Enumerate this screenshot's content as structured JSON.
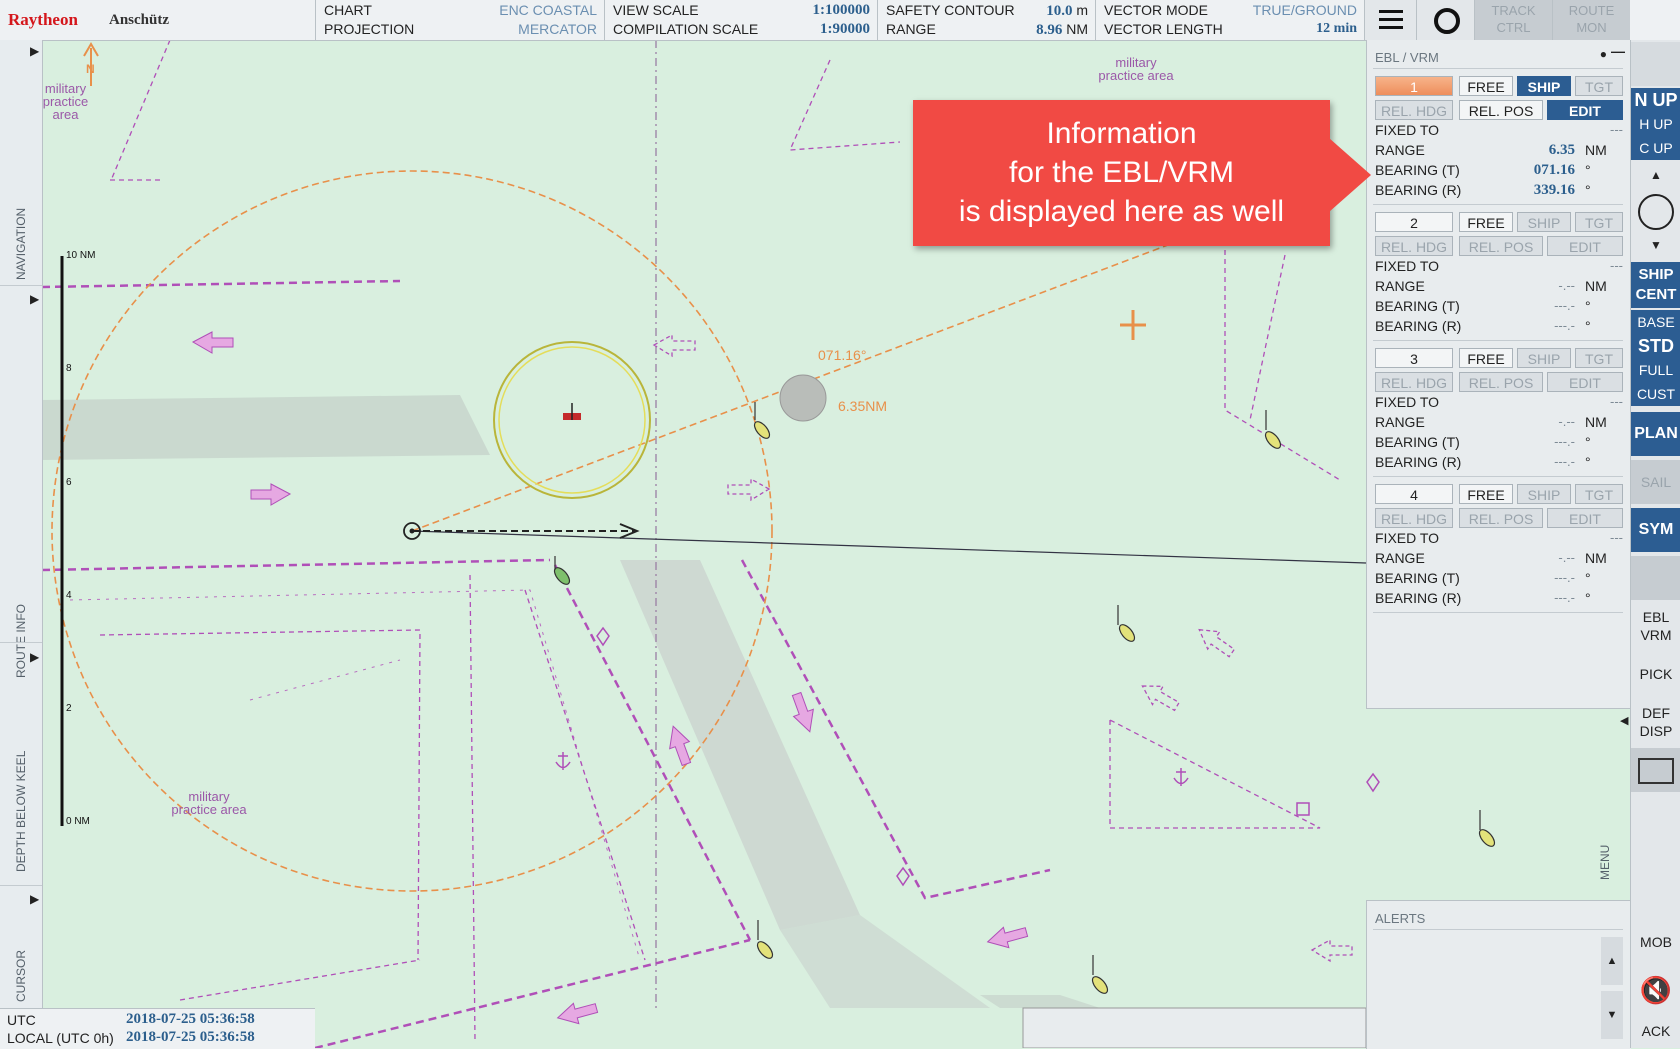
{
  "brand": {
    "name": "Raytheon",
    "sub": "Anschütz"
  },
  "topbar": {
    "chart_label": "CHART",
    "chart_value": "ENC  COASTAL",
    "projection_label": "PROJECTION",
    "projection_value": "MERCATOR",
    "view_scale_label": "VIEW SCALE",
    "view_scale_value": "1:100000",
    "compilation_scale_label": "COMPILATION SCALE",
    "compilation_scale_value": "1:90000",
    "safety_contour_label": "SAFETY CONTOUR",
    "safety_contour_value": "10.0",
    "safety_contour_unit": "m",
    "range_label": "RANGE",
    "range_value": "8.96",
    "range_unit": "NM",
    "vector_mode_label": "VECTOR MODE",
    "vector_mode_value": "TRUE/GROUND",
    "vector_length_label": "VECTOR LENGTH",
    "vector_length_value": "12 min",
    "track_ctrl": [
      "TRACK",
      "CTRL"
    ],
    "route_mon": [
      "ROUTE",
      "MON"
    ],
    "menu_icon": "hamburger-icon",
    "settings_icon": "circle-icon"
  },
  "sidebar": {
    "labels": [
      "NAVIGATION",
      "ROUTE INFO",
      "DEPTH BELOW KEEL",
      "CURSOR"
    ]
  },
  "time": {
    "utc_label": "UTC",
    "utc_value": "2018-07-25  05:36:58",
    "local_label": "LOCAL (UTC 0h)",
    "local_value": "2018-07-25  05:36:58"
  },
  "map": {
    "range_ticks": [
      "10 NM",
      "8",
      "6",
      "4",
      "2",
      "0 NM"
    ],
    "bearing_label": "071.16°",
    "distance_label": "6.35NM",
    "military_area_1": [
      "military",
      "practice area"
    ],
    "military_area_2": [
      "military",
      "practice area"
    ],
    "military_area_3": [
      "military",
      "practice area"
    ],
    "north_label": "N"
  },
  "panel": {
    "title": "EBL / VRM",
    "blocks": [
      {
        "num": "1",
        "free": "FREE",
        "ship": "SHIP",
        "tgt": "TGT",
        "rel_hdg": "REL. HDG",
        "rel_pos": "REL. POS",
        "edit": "EDIT",
        "fixed_label": "FIXED TO",
        "fixed_value": "---",
        "range_label": "RANGE",
        "range_value": "6.35",
        "range_unit": "NM",
        "bt_label": "BEARING (T)",
        "bt_value": "071.16",
        "bt_unit": "°",
        "br_label": "BEARING (R)",
        "br_value": "339.16",
        "br_unit": "°",
        "active": true
      },
      {
        "num": "2",
        "free": "FREE",
        "ship": "SHIP",
        "tgt": "TGT",
        "rel_hdg": "REL. HDG",
        "rel_pos": "REL. POS",
        "edit": "EDIT",
        "fixed_label": "FIXED TO",
        "fixed_value": "---",
        "range_label": "RANGE",
        "range_value": "-.--",
        "range_unit": "NM",
        "bt_label": "BEARING (T)",
        "bt_value": "---.-",
        "bt_unit": "°",
        "br_label": "BEARING (R)",
        "br_value": "---.-",
        "br_unit": "°",
        "active": false
      },
      {
        "num": "3",
        "free": "FREE",
        "ship": "SHIP",
        "tgt": "TGT",
        "rel_hdg": "REL. HDG",
        "rel_pos": "REL. POS",
        "edit": "EDIT",
        "fixed_label": "FIXED TO",
        "fixed_value": "---",
        "range_label": "RANGE",
        "range_value": "-.--",
        "range_unit": "NM",
        "bt_label": "BEARING (T)",
        "bt_value": "---.-",
        "bt_unit": "°",
        "br_label": "BEARING (R)",
        "br_value": "---.-",
        "br_unit": "°",
        "active": false
      },
      {
        "num": "4",
        "free": "FREE",
        "ship": "SHIP",
        "tgt": "TGT",
        "rel_hdg": "REL. HDG",
        "rel_pos": "REL. POS",
        "edit": "EDIT",
        "fixed_label": "FIXED TO",
        "fixed_value": "---",
        "range_label": "RANGE",
        "range_value": "-.--",
        "range_unit": "NM",
        "bt_label": "BEARING (T)",
        "bt_value": "---.-",
        "bt_unit": "°",
        "br_label": "BEARING (R)",
        "br_value": "---.-",
        "br_unit": "°",
        "active": false
      }
    ]
  },
  "callout": {
    "line1": "Information",
    "line2": "for the EBL/VRM",
    "line3": "is displayed here as well"
  },
  "alerts": {
    "title": "ALERTS"
  },
  "rightbar": {
    "n_up": "N UP",
    "h_up": "H UP",
    "c_up": "C UP",
    "ship_cent": [
      "SHIP",
      "CENT"
    ],
    "base": "BASE",
    "std": "STD",
    "full": "FULL",
    "cust": "CUST",
    "plan": "PLAN",
    "sail": "SAIL",
    "sym": "SYM",
    "ebl_vrm": [
      "EBL",
      "VRM"
    ],
    "pick": "PICK",
    "def_disp": [
      "DEF",
      "DISP"
    ],
    "mob": "MOB",
    "ack": "ACK",
    "menu": "MENU"
  },
  "colors": {
    "sea": "#d9efdf",
    "route": "#b04fb8",
    "ebl": "#e8904a",
    "accent_blue": "#2c5d92",
    "callout": "#f14a44"
  }
}
